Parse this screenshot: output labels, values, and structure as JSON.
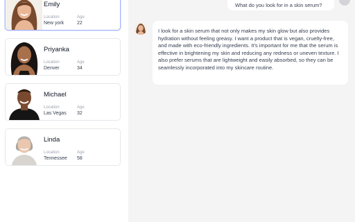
{
  "personas": [
    {
      "name": "Emily",
      "location_label": "Location",
      "location": "New york",
      "age_label": "Age",
      "age": "22",
      "active": true
    },
    {
      "name": "Priyanka",
      "location_label": "Location",
      "location": "Denver",
      "age_label": "Age",
      "age": "34",
      "active": false
    },
    {
      "name": "Michael",
      "location_label": "Location",
      "location": "Las Vegas",
      "age_label": "Age",
      "age": "32",
      "active": false
    },
    {
      "name": "Linda",
      "location_label": "Location",
      "location": "Tennessee",
      "age_label": "Age",
      "age": "58",
      "active": false
    }
  ],
  "chat": {
    "user_message": "What do you look for in a skin serum?",
    "bot_message": "I look for a skin serum that not only makes my skin glow but also provides hydration without feeling greasy. I want a product that is vegan, cruelty-free, and made with eco-friendly ingredients. It's important for me that the serum is effective in brightening my skin and reducing any redness or uneven texture. I also prefer serums that are lightweight and easily absorbed, so they can be seamlessly incorporated into my skincare routine."
  },
  "colors": {
    "active_border": "#a5b4fc",
    "chat_background": "#f4f4f5",
    "card_border": "#e5e7eb"
  }
}
